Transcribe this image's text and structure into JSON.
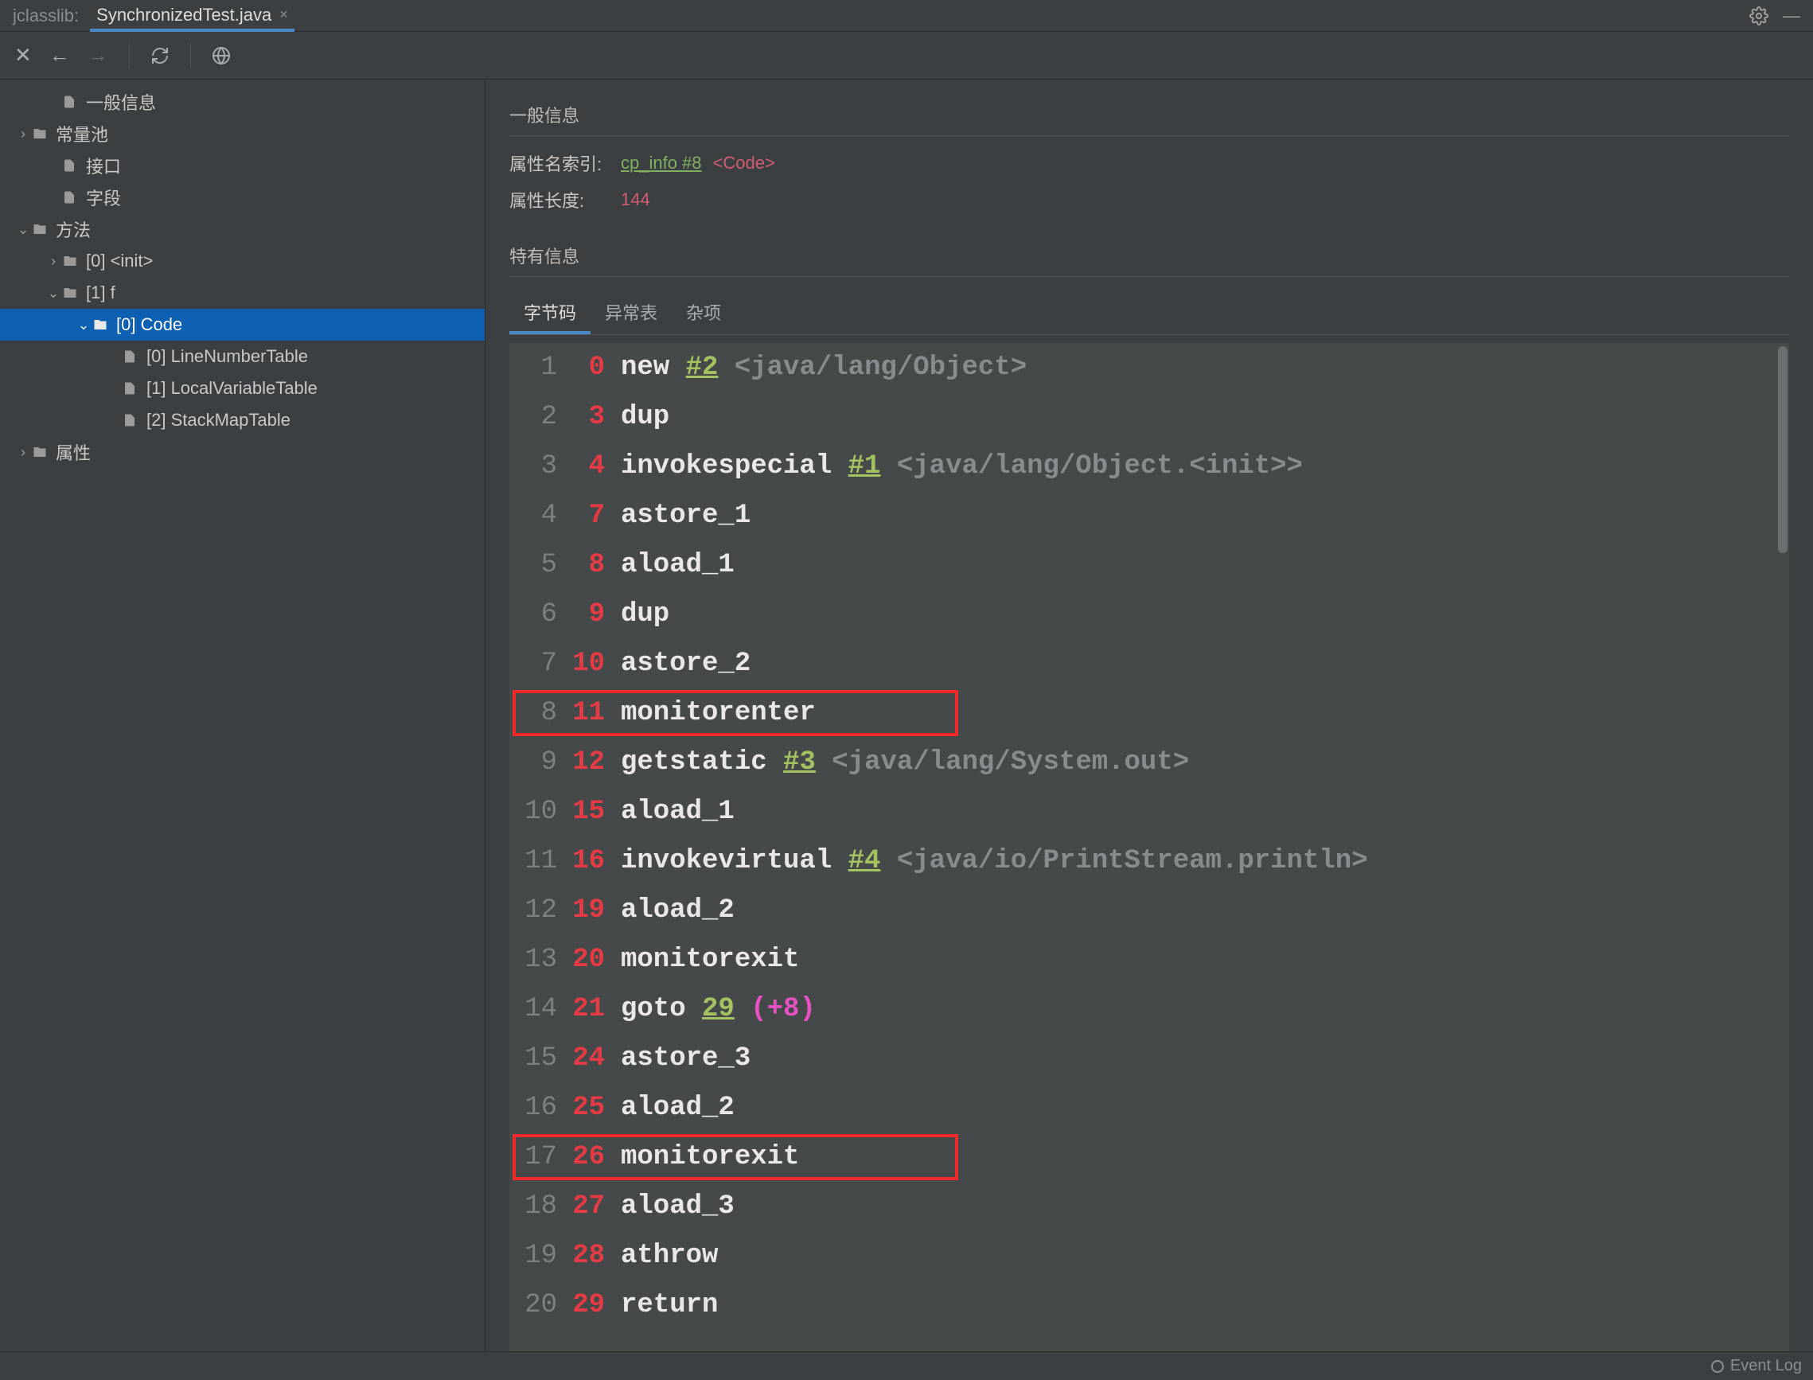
{
  "app_label": "jclasslib:",
  "tab_title": "SynchronizedTest.java",
  "tree": [
    {
      "indent": 1,
      "chevron": "",
      "icon": "file",
      "label": "一般信息",
      "sel": false
    },
    {
      "indent": 0,
      "chevron": "›",
      "icon": "folder",
      "label": "常量池",
      "sel": false
    },
    {
      "indent": 1,
      "chevron": "",
      "icon": "file",
      "label": "接口",
      "sel": false
    },
    {
      "indent": 1,
      "chevron": "",
      "icon": "file",
      "label": "字段",
      "sel": false
    },
    {
      "indent": 0,
      "chevron": "⌄",
      "icon": "folder",
      "label": "方法",
      "sel": false
    },
    {
      "indent": 1,
      "chevron": "›",
      "icon": "folder",
      "label": "[0] <init>",
      "sel": false
    },
    {
      "indent": 1,
      "chevron": "⌄",
      "icon": "folder",
      "label": "[1] f",
      "sel": false
    },
    {
      "indent": 2,
      "chevron": "⌄",
      "icon": "folder",
      "label": "[0] Code",
      "sel": true
    },
    {
      "indent": 3,
      "chevron": "",
      "icon": "file",
      "label": "[0] LineNumberTable",
      "sel": false
    },
    {
      "indent": 3,
      "chevron": "",
      "icon": "file",
      "label": "[1] LocalVariableTable",
      "sel": false
    },
    {
      "indent": 3,
      "chevron": "",
      "icon": "file",
      "label": "[2] StackMapTable",
      "sel": false
    },
    {
      "indent": 0,
      "chevron": "›",
      "icon": "folder",
      "label": "属性",
      "sel": false
    }
  ],
  "sections": {
    "general": "一般信息",
    "specific": "特有信息"
  },
  "attrs": {
    "name_idx_label": "属性名索引:",
    "name_idx_link": "cp_info #8",
    "name_idx_code": "<Code>",
    "len_label": "属性长度:",
    "len_val": "144"
  },
  "tabs": {
    "bytecode": "字节码",
    "exception": "异常表",
    "misc": "杂项"
  },
  "bytecode": [
    {
      "i": "1",
      "o": "0",
      "p": [
        [
          "instr",
          "new "
        ],
        [
          "pool",
          "#2"
        ],
        [
          "plain",
          " "
        ],
        [
          "cmt",
          "<java/lang/Object>"
        ]
      ]
    },
    {
      "i": "2",
      "o": "3",
      "p": [
        [
          "instr",
          "dup"
        ]
      ]
    },
    {
      "i": "3",
      "o": "4",
      "p": [
        [
          "instr",
          "invokespecial "
        ],
        [
          "pool",
          "#1"
        ],
        [
          "plain",
          " "
        ],
        [
          "cmt",
          "<java/lang/Object.<init>>"
        ]
      ]
    },
    {
      "i": "4",
      "o": "7",
      "p": [
        [
          "instr",
          "astore_1"
        ]
      ]
    },
    {
      "i": "5",
      "o": "8",
      "p": [
        [
          "instr",
          "aload_1"
        ]
      ]
    },
    {
      "i": "6",
      "o": "9",
      "p": [
        [
          "instr",
          "dup"
        ]
      ]
    },
    {
      "i": "7",
      "o": "10",
      "p": [
        [
          "instr",
          "astore_2"
        ]
      ]
    },
    {
      "i": "8",
      "o": "11",
      "p": [
        [
          "instr",
          "monitorenter"
        ]
      ],
      "hl": true
    },
    {
      "i": "9",
      "o": "12",
      "p": [
        [
          "instr",
          "getstatic "
        ],
        [
          "pool",
          "#3"
        ],
        [
          "plain",
          " "
        ],
        [
          "cmt",
          "<java/lang/System.out>"
        ]
      ]
    },
    {
      "i": "10",
      "o": "15",
      "p": [
        [
          "instr",
          "aload_1"
        ]
      ]
    },
    {
      "i": "11",
      "o": "16",
      "p": [
        [
          "instr",
          "invokevirtual "
        ],
        [
          "pool",
          "#4"
        ],
        [
          "plain",
          " "
        ],
        [
          "cmt",
          "<java/io/PrintStream.println>"
        ]
      ]
    },
    {
      "i": "12",
      "o": "19",
      "p": [
        [
          "instr",
          "aload_2"
        ]
      ]
    },
    {
      "i": "13",
      "o": "20",
      "p": [
        [
          "instr",
          "monitorexit"
        ]
      ]
    },
    {
      "i": "14",
      "o": "21",
      "p": [
        [
          "instr",
          "goto "
        ],
        [
          "jump",
          "29"
        ],
        [
          "plain",
          " "
        ],
        [
          "off",
          "(+8)"
        ]
      ]
    },
    {
      "i": "15",
      "o": "24",
      "p": [
        [
          "instr",
          "astore_3"
        ]
      ]
    },
    {
      "i": "16",
      "o": "25",
      "p": [
        [
          "instr",
          "aload_2"
        ]
      ]
    },
    {
      "i": "17",
      "o": "26",
      "p": [
        [
          "instr",
          "monitorexit"
        ]
      ],
      "hl": true
    },
    {
      "i": "18",
      "o": "27",
      "p": [
        [
          "instr",
          "aload_3"
        ]
      ]
    },
    {
      "i": "19",
      "o": "28",
      "p": [
        [
          "instr",
          "athrow"
        ]
      ]
    },
    {
      "i": "20",
      "o": "29",
      "p": [
        [
          "instr",
          "return"
        ]
      ]
    }
  ],
  "status": "Event Log"
}
